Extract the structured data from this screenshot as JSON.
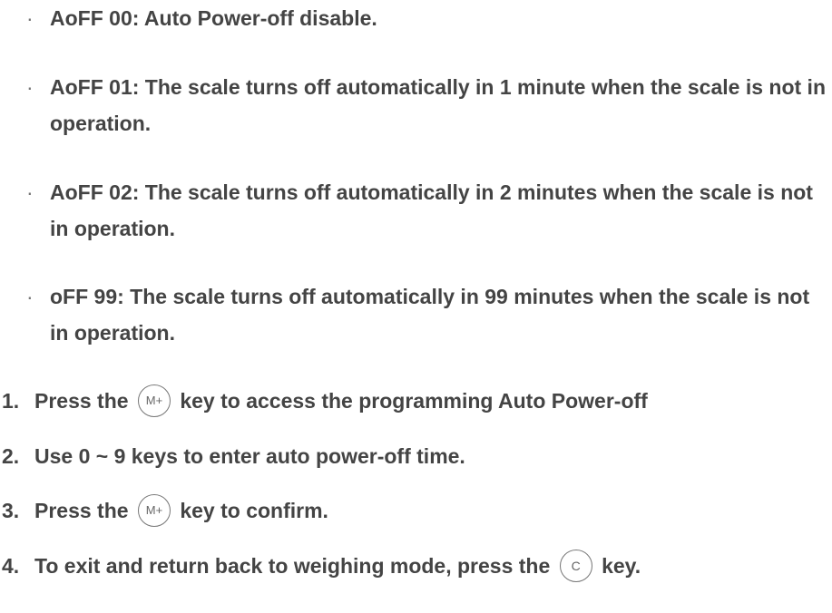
{
  "bullets": [
    {
      "marker": "·",
      "text": "AoFF 00: Auto Power-off disable."
    },
    {
      "marker": "·",
      "text": "AoFF 01: The scale turns off automatically in 1 minute when the scale is not in operation."
    },
    {
      "marker": "·",
      "text": "AoFF 02: The scale turns off automatically in 2 minutes when the scale is not in operation."
    },
    {
      "marker": "·",
      "text": "oFF 99: The scale turns off automatically in 99 minutes when the scale is not in operation."
    }
  ],
  "steps": [
    {
      "num": "1.",
      "before": "Press the",
      "key": "M+",
      "after": "key to access the programming Auto Power-off"
    },
    {
      "num": "2.",
      "text": "Use 0 ~ 9 keys to enter auto power-off time."
    },
    {
      "num": "3.",
      "before": "Press the",
      "key": "M+",
      "after": "key to confirm."
    },
    {
      "num": "4.",
      "before": "To exit and return back to weighing mode, press the",
      "key": "C",
      "after": "key."
    }
  ]
}
